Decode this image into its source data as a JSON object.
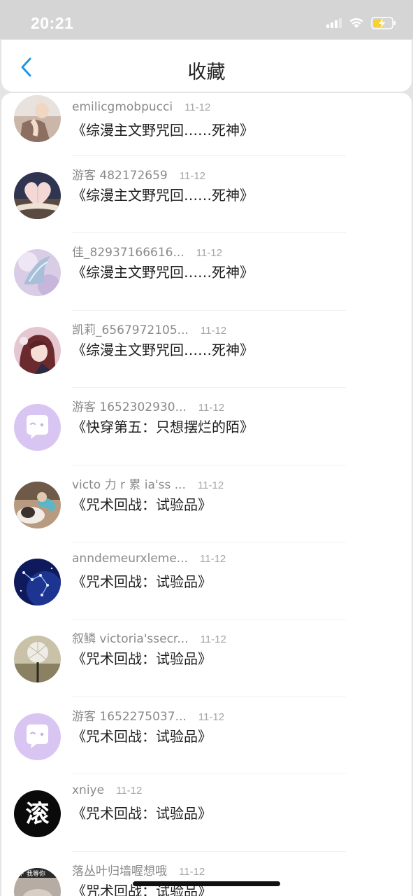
{
  "status_bar": {
    "time": "20:21"
  },
  "header": {
    "title": "收藏",
    "back_icon": "chevron-left-icon",
    "accent": "#2196e6"
  },
  "items": [
    {
      "user": "emilicgmobpucci",
      "date": "11-12",
      "book": "《综漫主文野咒回……死神》",
      "avatar": "photo"
    },
    {
      "user": "游客 482172659",
      "date": "11-12",
      "book": "《综漫主文野咒回……死神》",
      "avatar": "photo"
    },
    {
      "user": "佳_82937166616...",
      "date": "11-12",
      "book": "《综漫主文野咒回……死神》",
      "avatar": "photo"
    },
    {
      "user": "凯莉_6567972105...",
      "date": "11-12",
      "book": "《综漫主文野咒回……死神》",
      "avatar": "photo"
    },
    {
      "user": "游客 1652302930...",
      "date": "11-12",
      "book": "《快穿第五：只想摆烂的陌》",
      "avatar": "default-chat-bubble"
    },
    {
      "user": "victo 力 r 累 ia'ss ...",
      "date": "11-12",
      "book": "《咒术回战：试验品》",
      "avatar": "photo"
    },
    {
      "user": "anndemeurxleme...",
      "date": "11-12",
      "book": "《咒术回战：试验品》",
      "avatar": "photo"
    },
    {
      "user": "叙鳞 victoria'ssecr...",
      "date": "11-12",
      "book": "《咒术回战：试验品》",
      "avatar": "photo"
    },
    {
      "user": "游客 1652275037...",
      "date": "11-12",
      "book": "《咒术回战：试验品》",
      "avatar": "default-chat-bubble"
    },
    {
      "user": "xniye",
      "date": "11-12",
      "book": "《咒术回战：试验品》",
      "avatar": "photo"
    },
    {
      "user": "落丛叶归墙喔想哦",
      "date": "11-12",
      "book": "《咒术回战：试验品》",
      "avatar": "photo"
    }
  ],
  "avatar_text": {
    "xniye": "滚",
    "last": "下 我等你"
  }
}
